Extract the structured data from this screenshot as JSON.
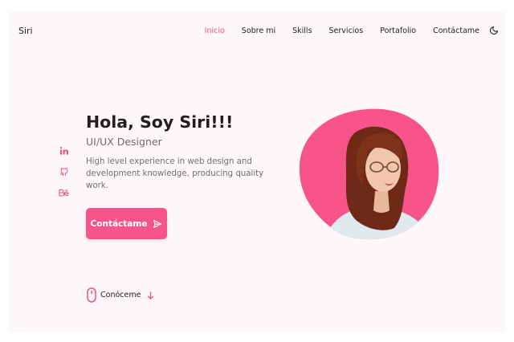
{
  "header": {
    "logo": "Siri",
    "nav": [
      {
        "label": "Inicio",
        "active": true
      },
      {
        "label": "Sobre mi",
        "active": false
      },
      {
        "label": "Skills",
        "active": false
      },
      {
        "label": "Servicios",
        "active": false
      },
      {
        "label": "Portafolio",
        "active": false
      },
      {
        "label": "Contáctame",
        "active": false
      }
    ],
    "theme_icon": "moon-icon"
  },
  "social": [
    {
      "icon": "linkedin-icon"
    },
    {
      "icon": "github-icon"
    },
    {
      "icon": "behance-icon"
    }
  ],
  "hero": {
    "title": "Hola, Soy Siri!!!",
    "subtitle": "UI/UX Designer",
    "description": "High level experience in web design and development knowledge, producing quality work.",
    "cta_label": "Contáctame",
    "cta_icon": "send-icon",
    "scroll_label": "Conóceme",
    "scroll_icon": "mouse-icon",
    "arrow_icon": "arrow-down-icon"
  },
  "colors": {
    "accent": "#f7558a",
    "nav_active": "#f0517f",
    "background": "#fdf7f9",
    "blob": "#f7558a"
  }
}
